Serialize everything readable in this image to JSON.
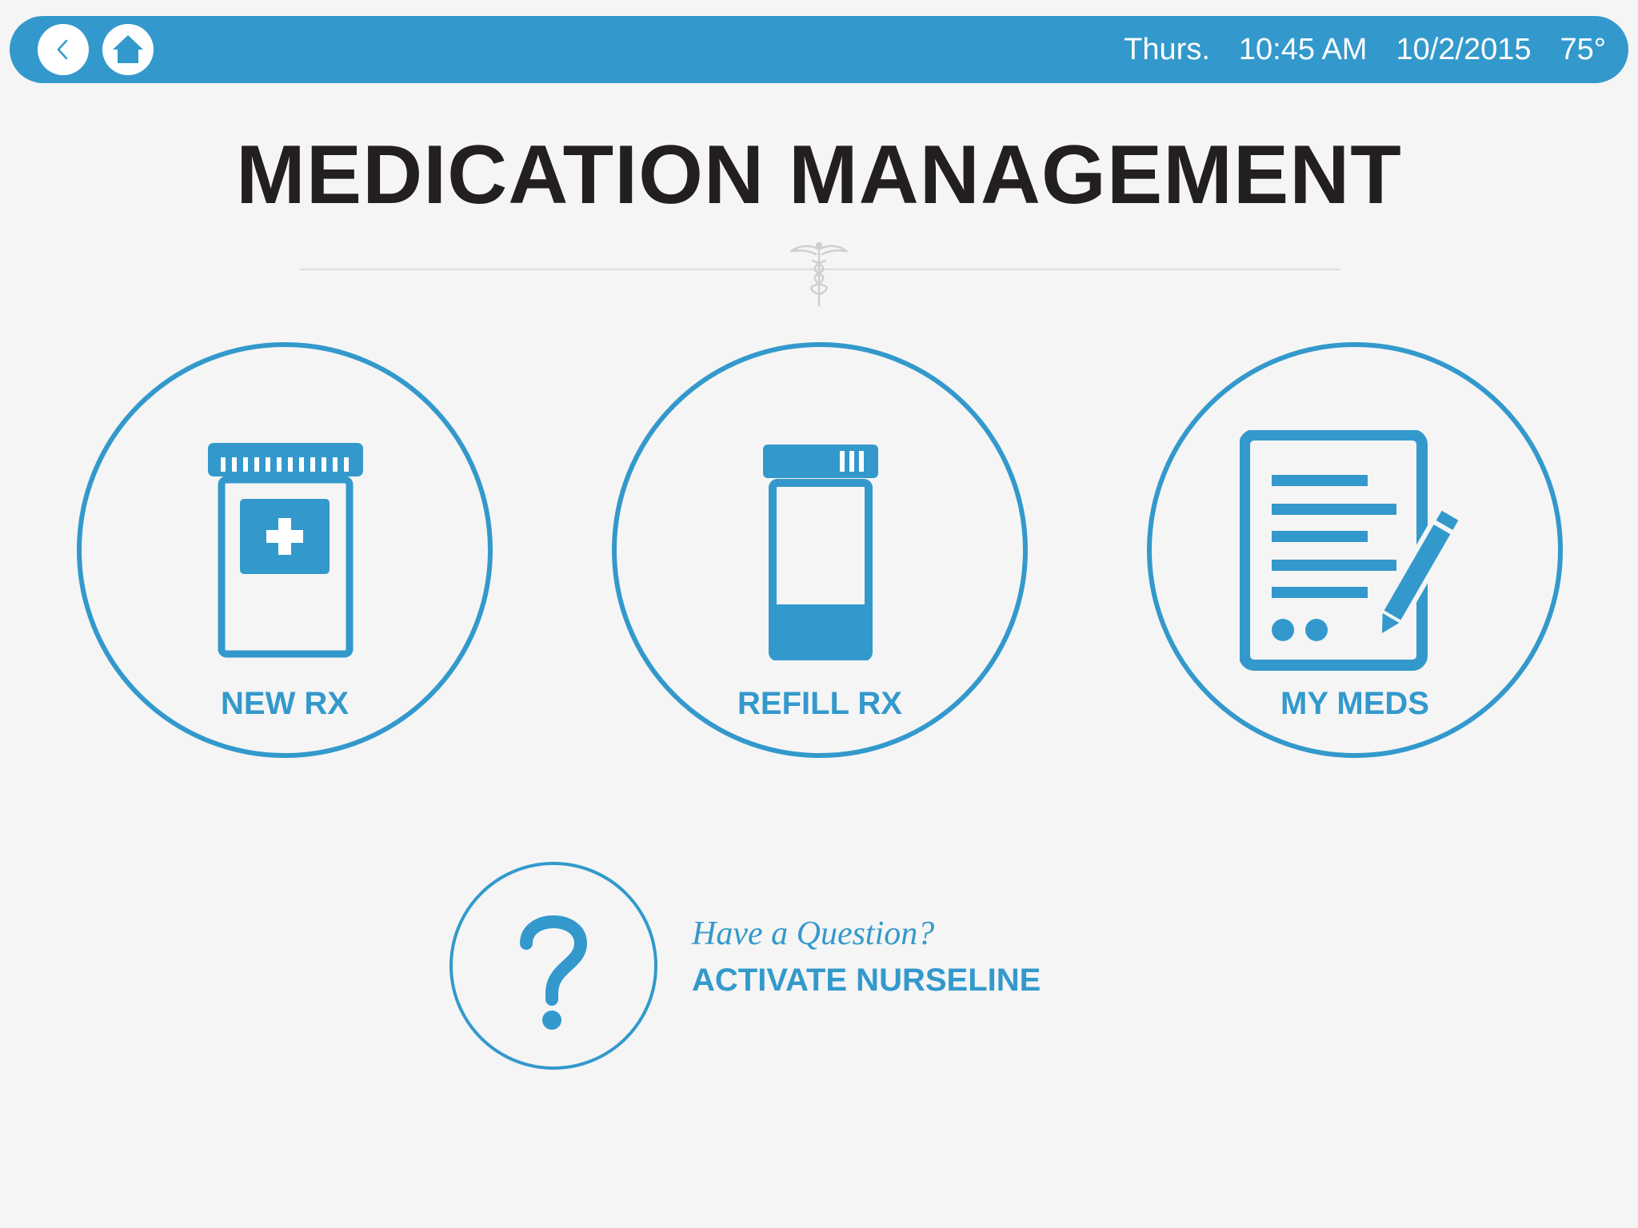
{
  "header": {
    "back_icon": "chevron-left-icon",
    "home_icon": "home-icon",
    "day": "Thurs.",
    "time": "10:45 AM",
    "date": "10/2/2015",
    "temperature": "75°"
  },
  "page": {
    "title": "MEDICATION MANAGEMENT",
    "divider_icon": "caduceus-icon"
  },
  "tiles": [
    {
      "label": "NEW RX",
      "icon": "pill-bottle-plus-icon"
    },
    {
      "label": "REFILL RX",
      "icon": "pill-bottle-icon"
    },
    {
      "label": "MY MEDS",
      "icon": "document-pencil-icon"
    }
  ],
  "help": {
    "icon": "question-mark-icon",
    "subtitle": "Have a Question?",
    "action": "ACTIVATE NURSELINE"
  },
  "colors": {
    "accent": "#3399cc",
    "background": "#f5f5f5",
    "title": "#231f20"
  }
}
